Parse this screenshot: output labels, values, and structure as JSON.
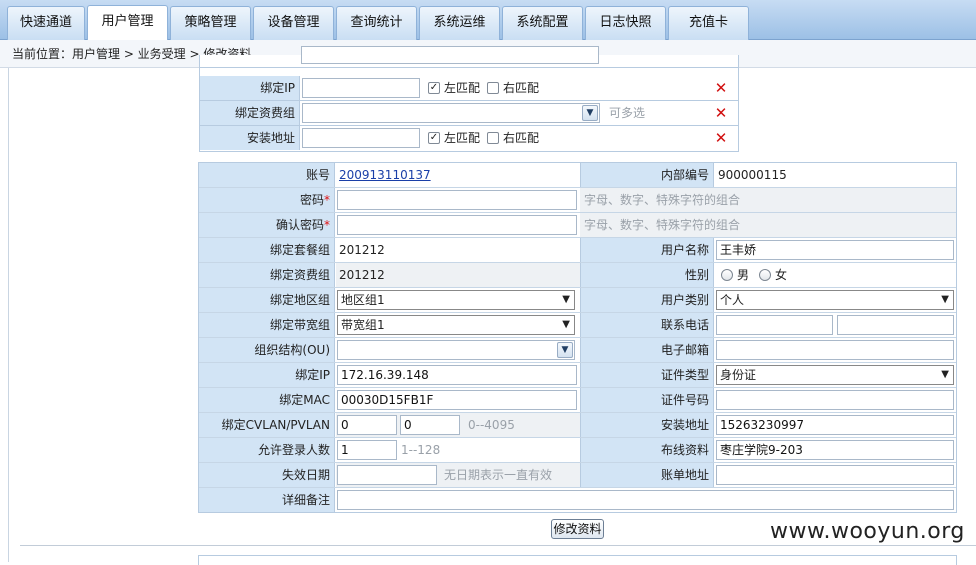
{
  "tabs": [
    {
      "label": "快速通道",
      "active": false
    },
    {
      "label": "用户管理",
      "active": true
    },
    {
      "label": "策略管理",
      "active": false
    },
    {
      "label": "设备管理",
      "active": false
    },
    {
      "label": "查询统计",
      "active": false
    },
    {
      "label": "系统运维",
      "active": false
    },
    {
      "label": "系统配置",
      "active": false
    },
    {
      "label": "日志快照",
      "active": false
    },
    {
      "label": "充值卡",
      "active": false
    }
  ],
  "breadcrumb": "当前位置：用户管理 > 业务受理 > 修改资料",
  "filter": {
    "bind_ip": {
      "label": "绑定IP",
      "left_match": "左匹配",
      "right_match": "右匹配"
    },
    "fee_group": {
      "label": "绑定资费组",
      "hint": "可多选"
    },
    "install_addr": {
      "label": "安装地址",
      "left_match": "左匹配",
      "right_match": "右匹配"
    },
    "delete_icon": "✕"
  },
  "form": {
    "account": {
      "label": "账号",
      "value": "200913110137"
    },
    "internal_no": {
      "label": "内部编号",
      "value": "900000115"
    },
    "password": {
      "label": "密码",
      "required": "*",
      "hint": "字母、数字、特殊字符的组合"
    },
    "confirm_password": {
      "label": "确认密码",
      "required": "*",
      "hint": "字母、数字、特殊字符的组合"
    },
    "package_group": {
      "label": "绑定套餐组",
      "value": "201212"
    },
    "user_name": {
      "label": "用户名称",
      "value": "王丰娇"
    },
    "fee_group": {
      "label": "绑定资费组",
      "value": "201212"
    },
    "gender": {
      "label": "性别",
      "male": "男",
      "female": "女"
    },
    "region_group": {
      "label": "绑定地区组",
      "value": "地区组1"
    },
    "user_type": {
      "label": "用户类别",
      "value": "个人"
    },
    "bandwidth_group": {
      "label": "绑定带宽组",
      "value": "带宽组1"
    },
    "phone": {
      "label": "联系电话"
    },
    "org_unit": {
      "label": "组织结构(OU)"
    },
    "email": {
      "label": "电子邮箱"
    },
    "bind_ip": {
      "label": "绑定IP",
      "value": "172.16.39.148"
    },
    "id_type": {
      "label": "证件类型",
      "value": "身份证"
    },
    "bind_mac": {
      "label": "绑定MAC",
      "value": "00030D15FB1F"
    },
    "id_number": {
      "label": "证件号码"
    },
    "vlan": {
      "label": "绑定CVLAN/PVLAN",
      "cvlan": "0",
      "pvlan": "0",
      "hint": "0--4095"
    },
    "install_addr": {
      "label": "安装地址",
      "value": "15263230997"
    },
    "max_logins": {
      "label": "允许登录人数",
      "value": "1",
      "hint": "1--128"
    },
    "wiring_info": {
      "label": "布线资料",
      "value": "枣庄学院9-203"
    },
    "expire_date": {
      "label": "失效日期",
      "hint": "无日期表示一直有效"
    },
    "bill_addr": {
      "label": "账单地址"
    },
    "remarks": {
      "label": "详细备注"
    }
  },
  "submit_label": "修改资料",
  "watermark": "www.wooyun.org",
  "colors": {
    "label_bg": "#d2e4f5",
    "delete": "#d10f0f",
    "required": "#e01010",
    "link": "#1a3fa8"
  }
}
